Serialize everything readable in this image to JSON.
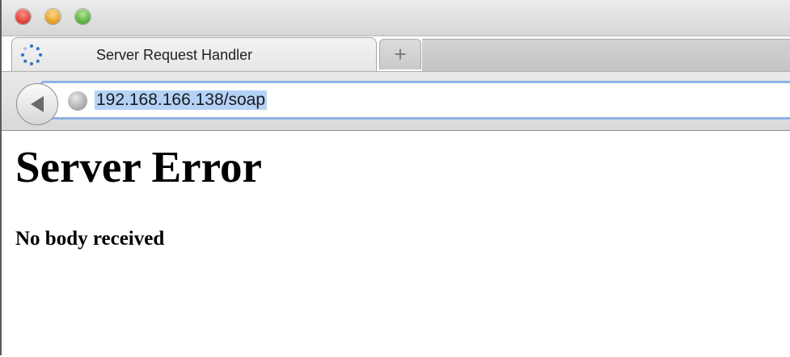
{
  "window": {
    "controls": [
      "close",
      "minimize",
      "zoom"
    ]
  },
  "tab": {
    "title": "Server Request Handler",
    "loading_icon": "spinner-icon",
    "new_tab_label": "+"
  },
  "toolbar": {
    "back_icon": "back-arrow-icon",
    "site_icon": "globe-icon",
    "url": "192.168.166.138/soap"
  },
  "page": {
    "heading": "Server Error",
    "message": "No body received"
  },
  "colors": {
    "url_selection": "#b4d2f7",
    "address_focus": "#8fb3e6",
    "spinner": "#2a73c9"
  }
}
